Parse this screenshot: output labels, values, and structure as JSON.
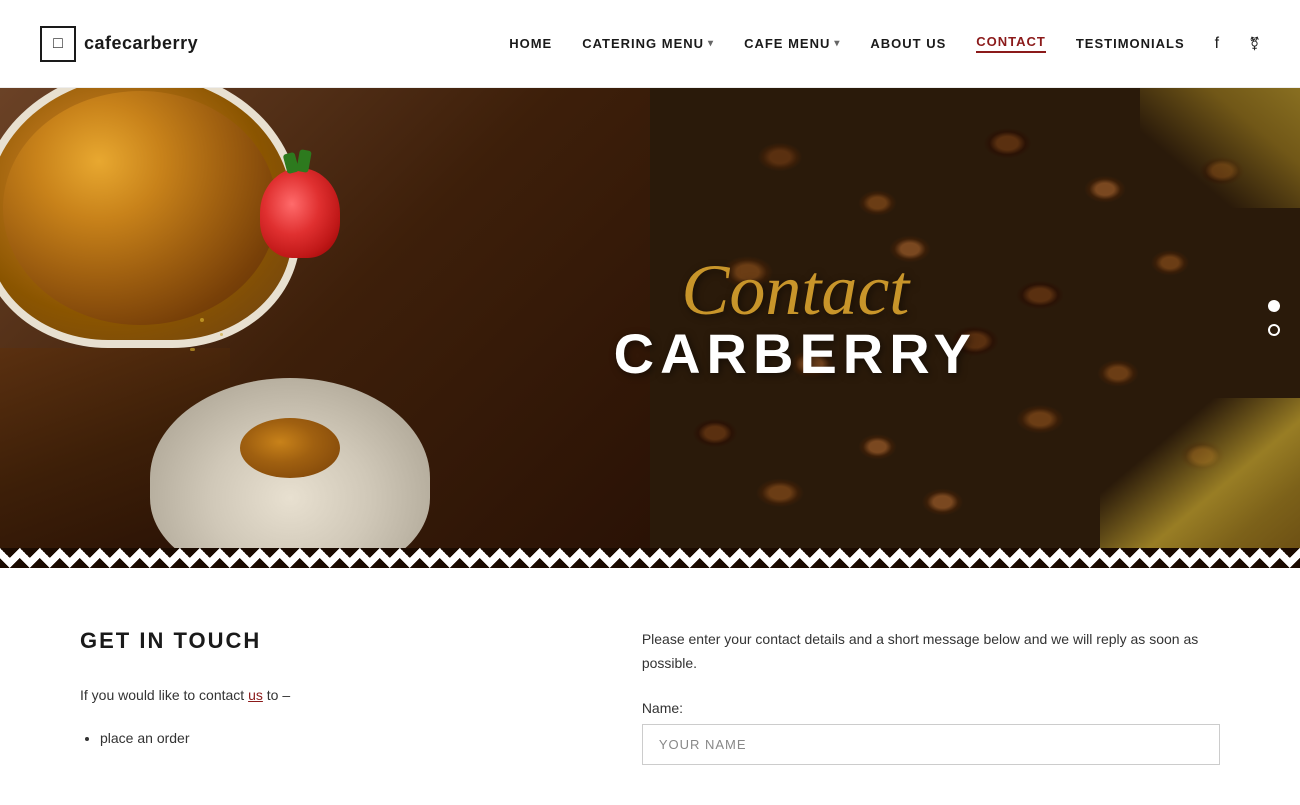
{
  "page": {
    "title": "cafecarberry - Contact"
  },
  "header": {
    "logo_text": "cafecarberry",
    "logo_icon": "□",
    "nav_items": [
      {
        "id": "home",
        "label": "HOME",
        "has_dropdown": false,
        "active": false
      },
      {
        "id": "catering-menu",
        "label": "CATERING MENU",
        "has_dropdown": true,
        "active": false
      },
      {
        "id": "cafe-menu",
        "label": "CAFE MENU",
        "has_dropdown": true,
        "active": false
      },
      {
        "id": "about-us",
        "label": "ABOUT US",
        "has_dropdown": false,
        "active": false
      },
      {
        "id": "contact",
        "label": "CONTACT",
        "has_dropdown": false,
        "active": true
      },
      {
        "id": "testimonials",
        "label": "TESTIMONIALS",
        "has_dropdown": false,
        "active": false
      }
    ],
    "social_facebook": "f",
    "social_tripadvisor": "⊕"
  },
  "hero": {
    "script_text": "Contact",
    "bold_text": "CARBERRY",
    "slider_dots": [
      {
        "active": true
      },
      {
        "active": false
      }
    ]
  },
  "content": {
    "left": {
      "title": "GET IN TOUCH",
      "intro": "If you would like to contact us to –",
      "intro_link": "us",
      "bullet_items": [
        "place an order"
      ]
    },
    "right": {
      "description": "Please enter your contact details and a short message below and we will reply as soon as possible.",
      "form": {
        "name_label": "Name:",
        "name_placeholder": "YOUR NAME"
      }
    }
  }
}
